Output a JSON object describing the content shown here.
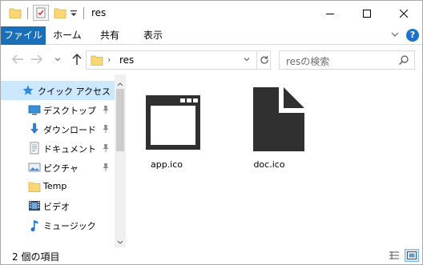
{
  "window": {
    "title": "res"
  },
  "quick_access_toolbar": {
    "icons": [
      "folder-icon",
      "properties-icon",
      "new-folder-icon",
      "customize-dropdown-icon"
    ]
  },
  "ribbon": {
    "tabs": [
      {
        "label": "ファイル",
        "active": true
      },
      {
        "label": "ホーム"
      },
      {
        "label": "共有"
      },
      {
        "label": "表示"
      }
    ],
    "help_label": "?"
  },
  "address_bar": {
    "path_segment": "res"
  },
  "search": {
    "placeholder": "resの検索"
  },
  "nav_pane": {
    "items": [
      {
        "label": "クイック アクセス",
        "icon": "star-icon",
        "selected": true
      },
      {
        "label": "デスクトップ",
        "icon": "desktop-icon",
        "pinned": true
      },
      {
        "label": "ダウンロード",
        "icon": "download-icon",
        "pinned": true
      },
      {
        "label": "ドキュメント",
        "icon": "documents-icon",
        "pinned": true
      },
      {
        "label": "ピクチャ",
        "icon": "pictures-icon",
        "pinned": true
      },
      {
        "label": "Temp",
        "icon": "folder-icon"
      },
      {
        "label": "ビデオ",
        "icon": "video-icon"
      },
      {
        "label": "ミュージック",
        "icon": "music-icon"
      }
    ]
  },
  "files": [
    {
      "name": "app.ico",
      "icon": "app-window-icon"
    },
    {
      "name": "doc.ico",
      "icon": "document-icon"
    }
  ],
  "status_bar": {
    "item_count": "2 個の項目"
  },
  "colors": {
    "accent": "#1a6fb9",
    "selection": "#cce8ff",
    "folder": "#f8d775"
  }
}
